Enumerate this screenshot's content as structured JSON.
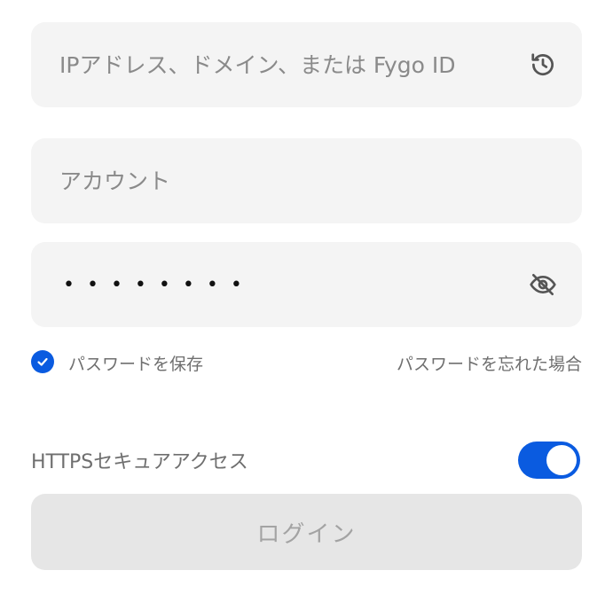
{
  "server_field": {
    "placeholder": "IPアドレス、ドメイン、または Fygo ID",
    "history_icon": "history-icon"
  },
  "account_field": {
    "placeholder": "アカウント"
  },
  "password_field": {
    "masked_value": "••••••••",
    "visibility_icon": "eye-off-icon"
  },
  "remember_password": {
    "label": "パスワードを保存",
    "checked": true
  },
  "forgot_password": {
    "label": "パスワードを忘れた場合"
  },
  "https_access": {
    "label": "HTTPSセキュアアクセス",
    "enabled": true
  },
  "login_button": {
    "label": "ログイン"
  },
  "colors": {
    "accent": "#0a5be0",
    "field_bg": "#f4f4f4",
    "button_disabled_bg": "#e6e6e6"
  }
}
